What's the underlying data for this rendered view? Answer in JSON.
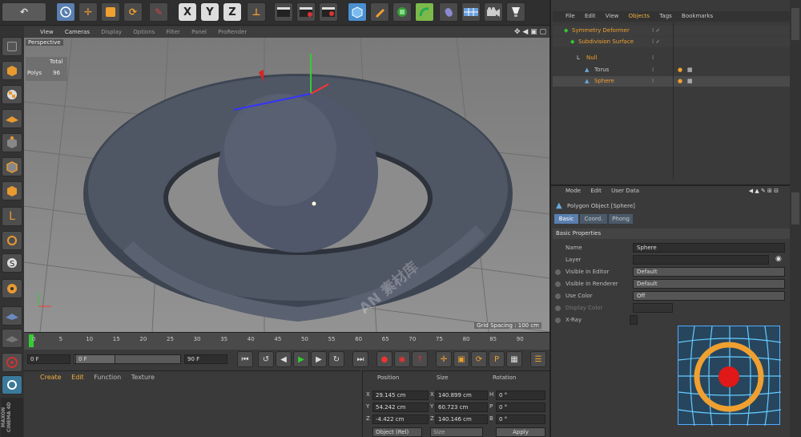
{
  "toolbar": {
    "undo": "↶",
    "axis_x": "X",
    "axis_y": "Y",
    "axis_z": "Z"
  },
  "viewport": {
    "menu": [
      "View",
      "Cameras",
      "Display",
      "Options",
      "Filter",
      "Panel",
      "ProRender"
    ],
    "label": "Perspective",
    "hud_total": "Total",
    "hud_polys": "Polys",
    "hud_count": "96",
    "grid_spacing": "Grid Spacing : 100 cm"
  },
  "timeline": {
    "ticks": [
      "0",
      "5",
      "10",
      "15",
      "20",
      "25",
      "30",
      "35",
      "40",
      "45",
      "50",
      "55",
      "60",
      "65",
      "70",
      "75",
      "80",
      "85",
      "90"
    ],
    "start_frame": "0 F",
    "current_frame": "0 F",
    "end_frame": "90 F",
    "max_frame": "0 F"
  },
  "materials": {
    "menu": [
      "Create",
      "Edit",
      "Function",
      "Texture"
    ]
  },
  "coords": {
    "headers": [
      "Position",
      "Size",
      "Rotation"
    ],
    "rows": [
      [
        "X",
        "29.145 cm",
        "X",
        "140.899 cm",
        "H",
        "0 °"
      ],
      [
        "Y",
        "54.242 cm",
        "Y",
        "60.723 cm",
        "P",
        "0 °"
      ],
      [
        "Z",
        "-4.422 cm",
        "Z",
        "140.146 cm",
        "B",
        "0 °"
      ]
    ],
    "mode": "Object (Rel)",
    "size_mode": "Size",
    "apply": "Apply"
  },
  "objects": {
    "menu": [
      "File",
      "Edit",
      "View",
      "Objects",
      "Tags",
      "Bookmarks"
    ],
    "items": [
      {
        "name": "Symmetry Deformer"
      },
      {
        "name": "Subdivision Surface"
      },
      {
        "name": "Null"
      },
      {
        "name": "Torus"
      },
      {
        "name": "Sphere"
      }
    ]
  },
  "attributes": {
    "menu": [
      "Mode",
      "Edit",
      "User Data"
    ],
    "object_title": "Polygon Object [Sphere]",
    "tabs": [
      "Basic",
      "Coord.",
      "Phong"
    ],
    "section": "Basic Properties",
    "rows": [
      {
        "label": "Name",
        "value": "Sphere"
      },
      {
        "label": "Layer",
        "value": ""
      },
      {
        "label": "Visible in Editor",
        "value": "Default"
      },
      {
        "label": "Visible in Renderer",
        "value": "Default"
      },
      {
        "label": "Use Color",
        "value": "Off"
      },
      {
        "label": "Display Color",
        "value": ""
      },
      {
        "label": "X-Ray",
        "value": ""
      }
    ]
  },
  "branding": {
    "logo": "MAXON CINEMA 4D",
    "watermark": "AN 素材库"
  },
  "colors": {
    "accent": "#f0a030",
    "selection": "#ffcc33",
    "panel": "#3a3a3a",
    "viewport": "#8a8a8a"
  }
}
